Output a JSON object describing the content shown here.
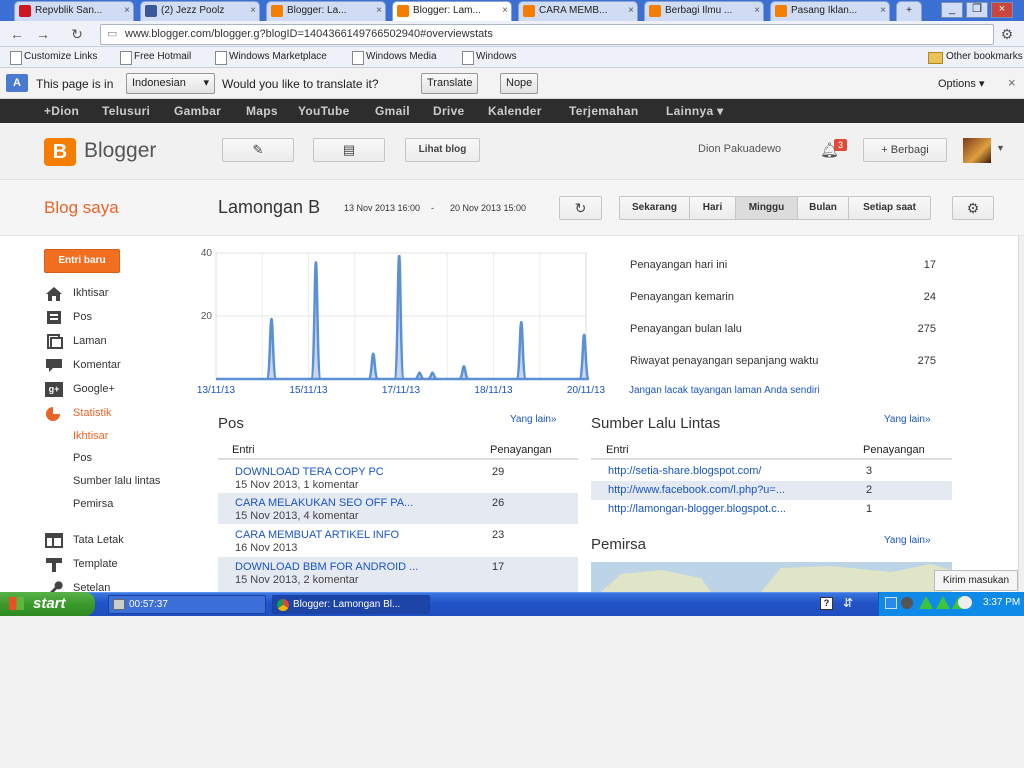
{
  "browser": {
    "tabs": [
      {
        "label": "Repvblik San...",
        "favicon": "youtube",
        "color": "#cc181e"
      },
      {
        "label": "(2) Jezz Poolz",
        "favicon": "facebook",
        "color": "#3b5998"
      },
      {
        "label": "Blogger: La...",
        "favicon": "blogger",
        "color": "#f57d00"
      },
      {
        "label": "Blogger: Lam...",
        "favicon": "blogger",
        "color": "#f57d00",
        "active": true
      },
      {
        "label": "CARA MEMB...",
        "favicon": "blogger",
        "color": "#f57d00"
      },
      {
        "label": "Berbagi Ilmu ...",
        "favicon": "blogger",
        "color": "#f57d00"
      },
      {
        "label": "Pasang Iklan...",
        "favicon": "blogger",
        "color": "#f57d00"
      }
    ],
    "url": "www.blogger.com/blogger.g?blogID=1404366149766502940#overviewstats",
    "bookmarks": [
      "Customize Links",
      "Free Hotmail",
      "Windows Marketplace",
      "Windows Media",
      "Windows"
    ],
    "other_bookmarks": "Other bookmarks"
  },
  "translate_bar": {
    "prefix": "This page is in",
    "language": "Indonesian",
    "question": "Would you like to translate it?",
    "translate_btn": "Translate",
    "nope_btn": "Nope",
    "options": "Options"
  },
  "google_bar": [
    "+Dion",
    "Telusuri",
    "Gambar",
    "Maps",
    "YouTube",
    "Gmail",
    "Drive",
    "Kalender",
    "Terjemahan",
    "Lainnya"
  ],
  "header": {
    "brand": "Blogger",
    "view_blog": "Lihat blog",
    "user_name": "Dion Pakuadewo",
    "notif_count": "3",
    "share": "Berbagi"
  },
  "subheader": {
    "my_blogs": "Blog saya",
    "blog_name": "Lamongan B",
    "range_start": "13 Nov 2013 16:00",
    "range_end": "20 Nov 2013 15:00",
    "periods": [
      "Sekarang",
      "Hari",
      "Minggu",
      "Bulan",
      "Setiap saat"
    ],
    "selected_period": "Minggu"
  },
  "sidebar": {
    "new_post": "Entri baru",
    "items": [
      {
        "label": "Ikhtisar",
        "icon": "home-icon"
      },
      {
        "label": "Pos",
        "icon": "posts-icon"
      },
      {
        "label": "Laman",
        "icon": "pages-icon"
      },
      {
        "label": "Komentar",
        "icon": "comment-icon"
      },
      {
        "label": "Google+",
        "icon": "googleplus-icon"
      },
      {
        "label": "Statistik",
        "icon": "stats-icon",
        "active": true
      }
    ],
    "stats_sub": [
      "Ikhtisar",
      "Pos",
      "Sumber lalu lintas",
      "Pemirsa"
    ],
    "more_items": [
      {
        "label": "Tata Letak",
        "icon": "layout-icon"
      },
      {
        "label": "Template",
        "icon": "template-icon"
      },
      {
        "label": "Setelan",
        "icon": "settings-icon"
      }
    ]
  },
  "chart_data": {
    "type": "area",
    "x_ticks": [
      "13/11/13",
      "15/11/13",
      "17/11/13",
      "18/11/13",
      "20/11/13"
    ],
    "y_ticks": [
      20,
      40
    ],
    "ylim": [
      0,
      40
    ],
    "color": "#5b8fd6",
    "peaks": [
      {
        "pos": 0.15,
        "value": 19
      },
      {
        "pos": 0.27,
        "value": 37
      },
      {
        "pos": 0.425,
        "value": 8
      },
      {
        "pos": 0.495,
        "value": 39
      },
      {
        "pos": 0.55,
        "value": 2
      },
      {
        "pos": 0.585,
        "value": 2
      },
      {
        "pos": 0.67,
        "value": 4
      },
      {
        "pos": 0.825,
        "value": 18
      },
      {
        "pos": 0.995,
        "value": 14
      }
    ]
  },
  "pageviews": {
    "rows": [
      {
        "label": "Penayangan hari ini",
        "value": "17"
      },
      {
        "label": "Penayangan kemarin",
        "value": "24"
      },
      {
        "label": "Penayangan bulan lalu",
        "value": "275"
      },
      {
        "label": "Riwayat penayangan sepanjang waktu",
        "value": "275"
      }
    ],
    "exclude_link": "Jangan lacak tayangan laman Anda sendiri"
  },
  "posts": {
    "title": "Pos",
    "more": "Yang lain»",
    "col_entry": "Entri",
    "col_views": "Penayangan",
    "rows": [
      {
        "title": "DOWNLOAD TERA COPY PC",
        "meta": "15 Nov 2013, 1 komentar",
        "views": "29"
      },
      {
        "title": "CARA MELAKUKAN SEO OFF PA...",
        "meta": "15 Nov 2013, 4 komentar",
        "views": "26"
      },
      {
        "title": "CARA MEMBUAT ARTIKEL INFO",
        "meta": "16 Nov 2013",
        "views": "23"
      },
      {
        "title": "DOWNLOAD BBM FOR ANDROID ...",
        "meta": "15 Nov 2013, 2 komentar",
        "views": "17"
      }
    ]
  },
  "traffic": {
    "title": "Sumber Lalu Lintas",
    "more": "Yang lain»",
    "col_entry": "Entri",
    "col_views": "Penayangan",
    "rows": [
      {
        "url": "http://setia-share.blogspot.com/",
        "views": "3"
      },
      {
        "url": "http://www.facebook.com/l.php?u=...",
        "views": "2"
      },
      {
        "url": "http://lamongan-blogger.blogspot.c...",
        "views": "1"
      }
    ]
  },
  "audience": {
    "title": "Pemirsa",
    "more": "Yang lain»"
  },
  "feedback_btn": "Kirim masukan",
  "taskbar": {
    "start": "start",
    "tasks": [
      "00:57:37",
      "Blogger: Lamongan Bl..."
    ],
    "clock": "3:37 PM"
  }
}
